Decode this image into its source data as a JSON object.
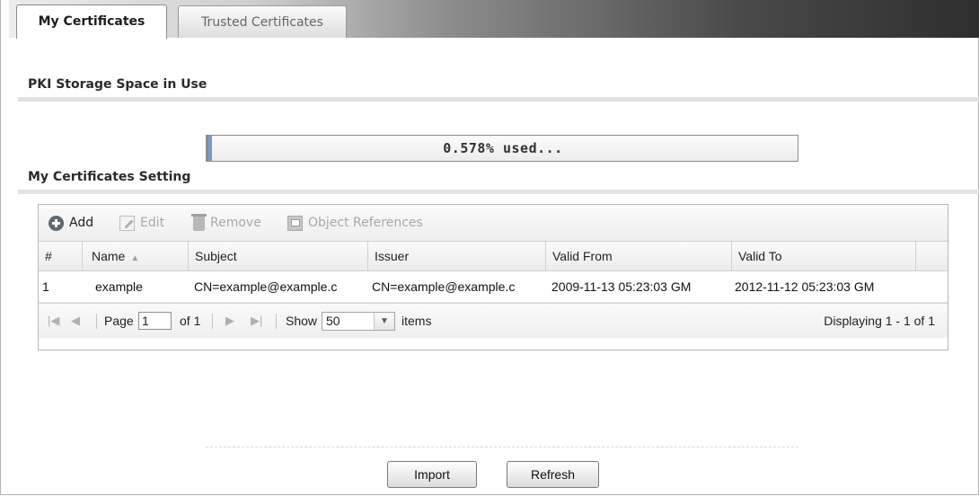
{
  "tabs": [
    {
      "label": "My Certificates",
      "active": true
    },
    {
      "label": "Trusted Certificates",
      "active": false
    }
  ],
  "storage": {
    "title": "PKI Storage Space in Use",
    "used_percent": 0.578,
    "text": "0.578% used..."
  },
  "settings": {
    "title": "My Certificates Setting",
    "toolbar": {
      "add": "Add",
      "edit": "Edit",
      "remove": "Remove",
      "object_references": "Object References"
    },
    "columns": [
      "#",
      "Name",
      "Subject",
      "Issuer",
      "Valid From",
      "Valid To"
    ],
    "sort_column": "Name",
    "rows": [
      {
        "index": "1",
        "name": "example",
        "subject": "CN=example@example.c",
        "issuer": "CN=example@example.c",
        "valid_from": "2009-11-13 05:23:03 GM",
        "valid_to": "2012-11-12 05:23:03 GM"
      }
    ],
    "pager": {
      "page_label": "Page",
      "page_value": "1",
      "of_label": "of 1",
      "show_label": "Show",
      "show_value": "50",
      "items_label": "items",
      "displaying": "Displaying 1 - 1 of 1"
    }
  },
  "buttons": {
    "import": "Import",
    "refresh": "Refresh"
  }
}
